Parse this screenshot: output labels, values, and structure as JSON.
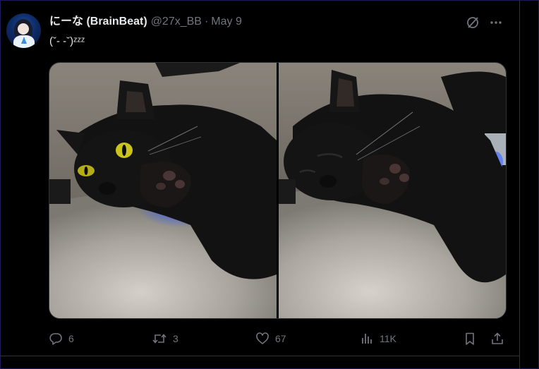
{
  "author": {
    "display_name": "にーな (BrainBeat)",
    "handle": "@27x_BB",
    "separator": "·",
    "date": "May 9"
  },
  "tweet": {
    "text": "(ˇ- -ˇ)ᶻᶻᶻ"
  },
  "media": {
    "photos": [
      {
        "subject": "black cat with yellow eyes lying on grey blanket"
      },
      {
        "subject": "black cat sleeping on grey blanket"
      }
    ]
  },
  "actions": {
    "replies": "6",
    "reposts": "3",
    "likes": "67",
    "views": "11K"
  },
  "icons": {
    "grok": "grok-icon",
    "more": "more-icon",
    "reply": "reply-icon",
    "repost": "repost-icon",
    "like": "heart-icon",
    "views": "bar-chart-icon",
    "bookmark": "bookmark-icon",
    "share": "share-icon"
  },
  "colors": {
    "background": "#000000",
    "text_primary": "#e7e9ea",
    "text_secondary": "#71767b",
    "border": "#2f3336"
  }
}
